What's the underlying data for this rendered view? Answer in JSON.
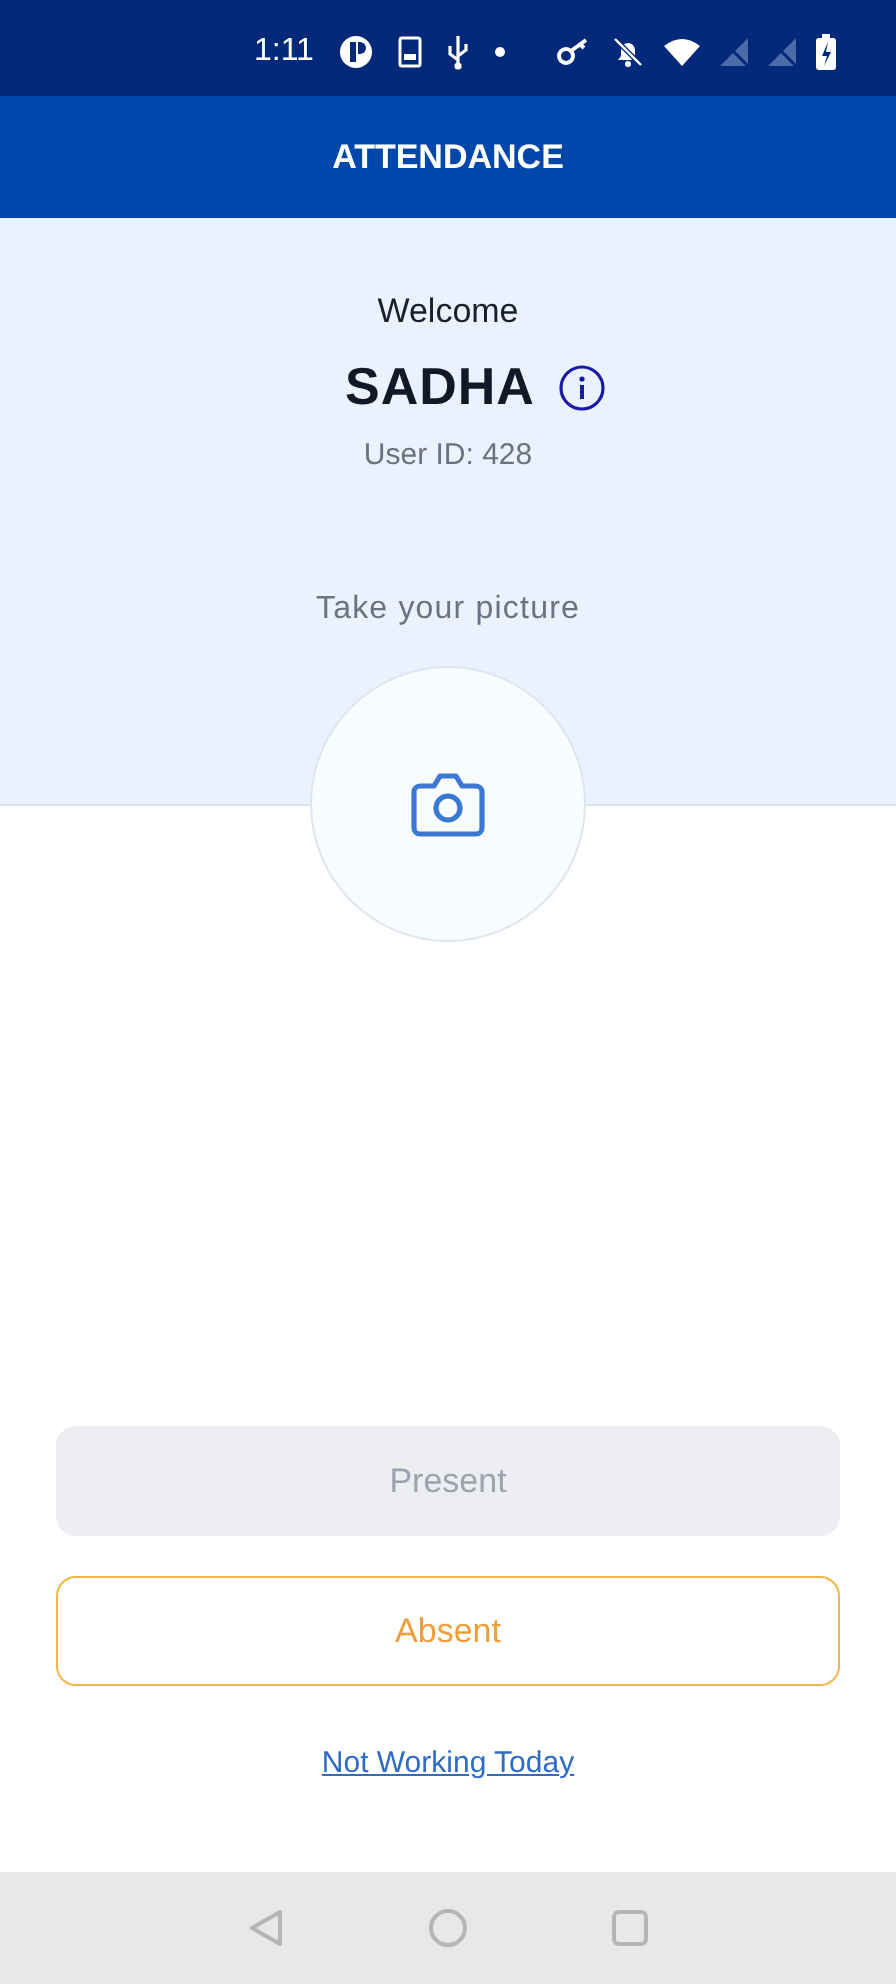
{
  "status_bar": {
    "time": "1:11"
  },
  "app_bar": {
    "title": "ATTENDANCE"
  },
  "profile": {
    "greeting": "Welcome",
    "name": "SADHA",
    "user_id": "User ID: 428"
  },
  "photo": {
    "prompt": "Take your picture"
  },
  "buttons": [
    {
      "label": "Present",
      "kind": "filled",
      "disabled": true
    },
    {
      "label": "Absent",
      "kind": "outlined",
      "disabled": false
    }
  ],
  "link": "Not Working Today"
}
